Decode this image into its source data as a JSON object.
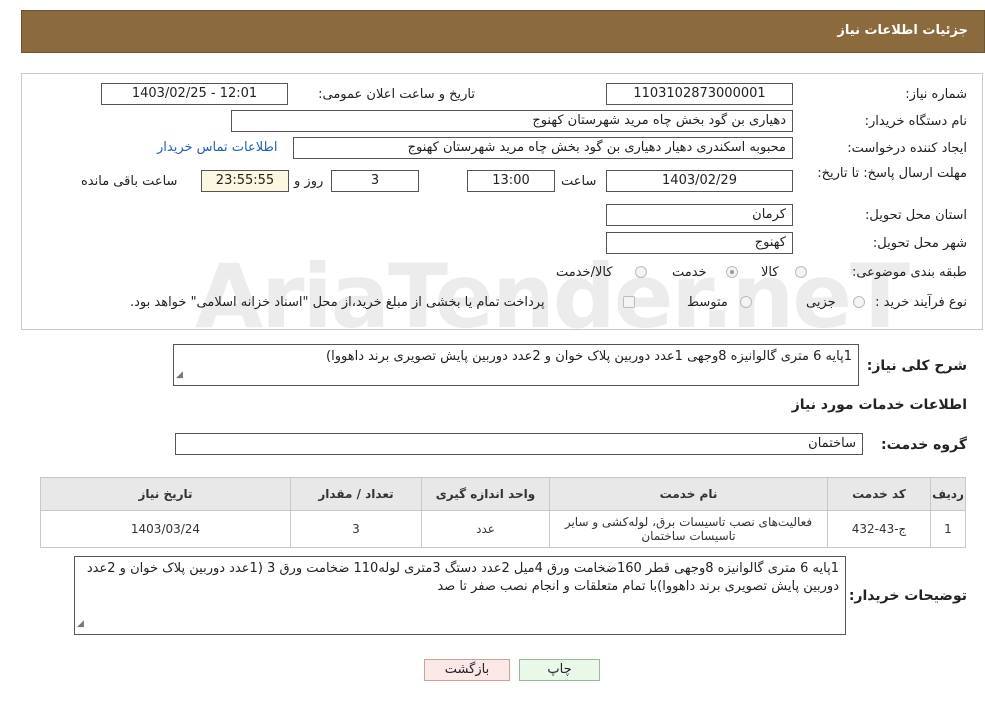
{
  "header": {
    "title": "جزئیات اطلاعات نیاز"
  },
  "form": {
    "need_number": {
      "label": "شماره نیاز:",
      "value": "1103102873000001"
    },
    "announce_datetime": {
      "label": "تاریخ و ساعت اعلان عمومی:",
      "value": "1403/02/25 - 12:01"
    },
    "buyer_org": {
      "label": "نام دستگاه خریدار:",
      "value": "دهیاری بن گود بخش چاه مرید شهرستان کهنوج"
    },
    "requester": {
      "label": "ایجاد کننده درخواست:",
      "value": "محبوبه اسکندری دهیار دهیاری بن گود بخش چاه مرید شهرستان کهنوج",
      "contact_link": "اطلاعات تماس خریدار"
    },
    "deadline": {
      "label": "مهلت ارسال پاسخ: تا تاریخ:",
      "date": "1403/02/29",
      "time_label": "ساعت",
      "time": "13:00",
      "days": "3",
      "days_label": "روز و",
      "remaining": "23:55:55",
      "remaining_label": "ساعت باقی مانده"
    },
    "province": {
      "label": "استان محل تحویل:",
      "value": "کرمان"
    },
    "city": {
      "label": "شهر محل تحویل:",
      "value": "کهنوج"
    },
    "category": {
      "label": "طبقه بندی موضوعی:",
      "options": [
        {
          "label": "کالا",
          "checked": false
        },
        {
          "label": "خدمت",
          "checked": true
        },
        {
          "label": "کالا/خدمت",
          "checked": false
        }
      ]
    },
    "purchase_type": {
      "label": "نوع فرآیند خرید :",
      "options": [
        {
          "label": "جزیی",
          "checked": false
        },
        {
          "label": "متوسط",
          "checked": false
        }
      ],
      "note": "پرداخت تمام یا بخشی از مبلغ خرید،از محل \"اسناد خزانه اسلامی\" خواهد بود."
    }
  },
  "summary": {
    "label": "شرح کلی نیاز:",
    "value": "1پایه 6 متری گالوانیزه 8وجهی 1عدد دوربین پلاک خوان و 2عدد دوربین پایش تصویری برند داهووا)"
  },
  "services_section": {
    "title": "اطلاعات خدمات مورد نیاز"
  },
  "service_group": {
    "label": "گروه خدمت:",
    "value": "ساختمان"
  },
  "table": {
    "headers": [
      "ردیف",
      "کد خدمت",
      "نام خدمت",
      "واحد اندازه گیری",
      "تعداد / مقدار",
      "تاریخ نیاز"
    ],
    "rows": [
      [
        "1",
        "ج-43-432",
        "فعالیت‌های نصب تاسیسات برق، لوله‌کشی و سایر تاسیسات ساختمان",
        "عدد",
        "3",
        "1403/03/24"
      ]
    ]
  },
  "buyer_notes": {
    "label": "توضیحات خریدار:",
    "value": "1پایه 6 متری گالوانیزه 8وجهی قطر 160ضخامت ورق 4میل 2عدد دستگ 3متری لوله110 ضخامت ورق 3 (1عدد دوربین پلاک خوان و 2عدد دوربین پایش تصویری برند داهووا)با تمام متعلقات و انجام نصب صفر تا صد"
  },
  "buttons": {
    "print": "چاپ",
    "back": "بازگشت"
  },
  "watermark": "AriaTender.neT"
}
